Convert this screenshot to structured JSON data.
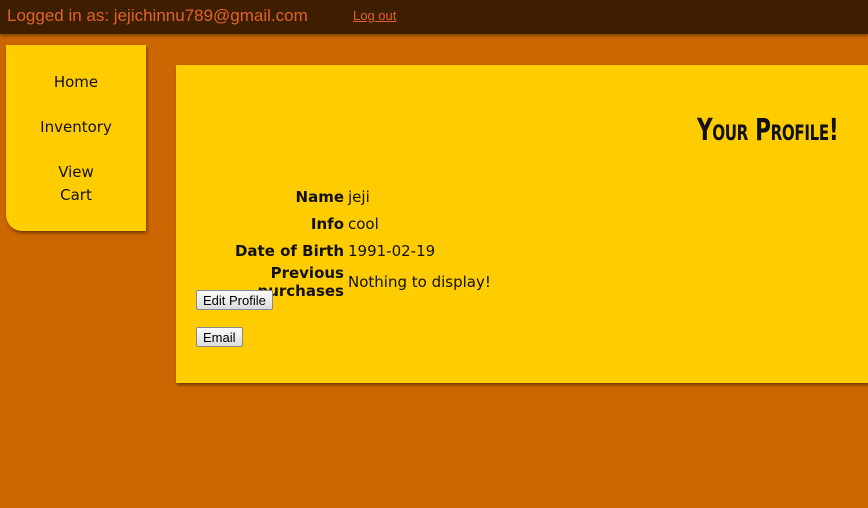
{
  "header": {
    "logged_in_text": "Logged in as: jejichinnu789@gmail.com",
    "logout_label": "Log out"
  },
  "sidebar": {
    "items": [
      {
        "label": "Home"
      },
      {
        "label": "Inventory"
      },
      {
        "label_line1": "View",
        "label_line2": "Cart"
      }
    ]
  },
  "profile": {
    "title": "Your Profile!",
    "fields": [
      {
        "label": "Name",
        "value": "jeji"
      },
      {
        "label": "Info",
        "value": "cool"
      },
      {
        "label": "Date of Birth",
        "value": "1991-02-19"
      },
      {
        "label": "Previous purchases",
        "value": "Nothing to display!"
      }
    ],
    "edit_button_label": "Edit Profile",
    "email_button_label": "Email"
  },
  "colors": {
    "page_background": "#cc6600",
    "header_background": "#3d1f00",
    "panel_background": "#ffcc00",
    "header_text": "#e0622a"
  }
}
